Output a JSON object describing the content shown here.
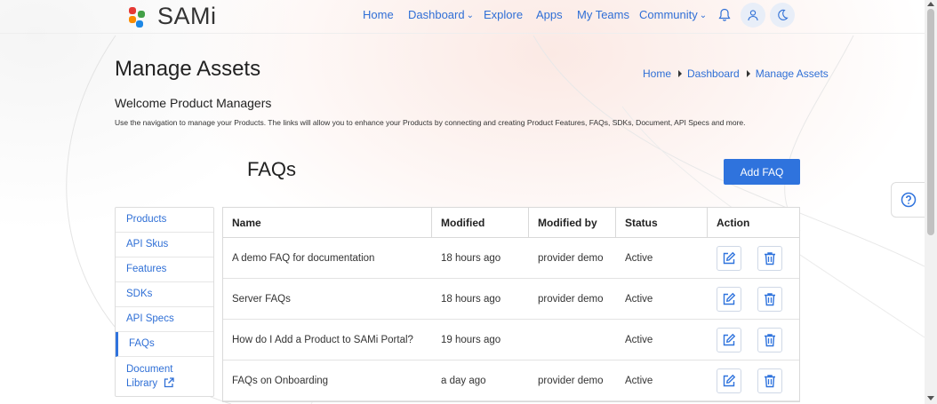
{
  "brand": {
    "name": "SAMi"
  },
  "nav": {
    "home": "Home",
    "dashboard": "Dashboard",
    "explore": "Explore",
    "apps": "Apps",
    "my_teams": "My Teams",
    "community": "Community"
  },
  "header_icons": [
    "bell-icon",
    "user-icon",
    "moon-icon"
  ],
  "page": {
    "title": "Manage Assets",
    "breadcrumb": [
      "Home",
      "Dashboard",
      "Manage Assets"
    ],
    "welcome": "Welcome Product Managers",
    "description": "Use the navigation to manage your Products. The links will allow you to enhance your Products by connecting and creating Product Features, FAQs, SDKs, Document, API Specs and more."
  },
  "sidebar": {
    "items": [
      {
        "label": "Products"
      },
      {
        "label": "API Skus"
      },
      {
        "label": "Features"
      },
      {
        "label": "SDKs"
      },
      {
        "label": "API Specs"
      },
      {
        "label": "FAQs",
        "active": true
      },
      {
        "label": "Document Library",
        "line1": "Document",
        "line2": "Library",
        "icon": "external-link-icon"
      }
    ]
  },
  "section": {
    "title": "FAQs",
    "add_button": "Add FAQ"
  },
  "table": {
    "headers": [
      "Name",
      "Modified",
      "Modified by",
      "Status",
      "Action"
    ],
    "rows": [
      [
        "A demo FAQ for documentation",
        "18 hours ago",
        "provider demo",
        "Active"
      ],
      [
        "Server FAQs",
        "18 hours ago",
        "provider demo",
        "Active"
      ],
      [
        "How do I Add a Product to SAMi Portal?",
        "19 hours ago",
        "",
        "Active"
      ],
      [
        "FAQs on Onboarding",
        "a day ago",
        "provider demo",
        "Active"
      ]
    ],
    "row_actions": [
      "edit-icon",
      "trash-icon"
    ]
  },
  "colors": {
    "accent": "#2f73dd",
    "link": "#2f6fd6",
    "logo": [
      "#e53935",
      "#43a047",
      "#fb8c00",
      "#1e88e5"
    ]
  }
}
